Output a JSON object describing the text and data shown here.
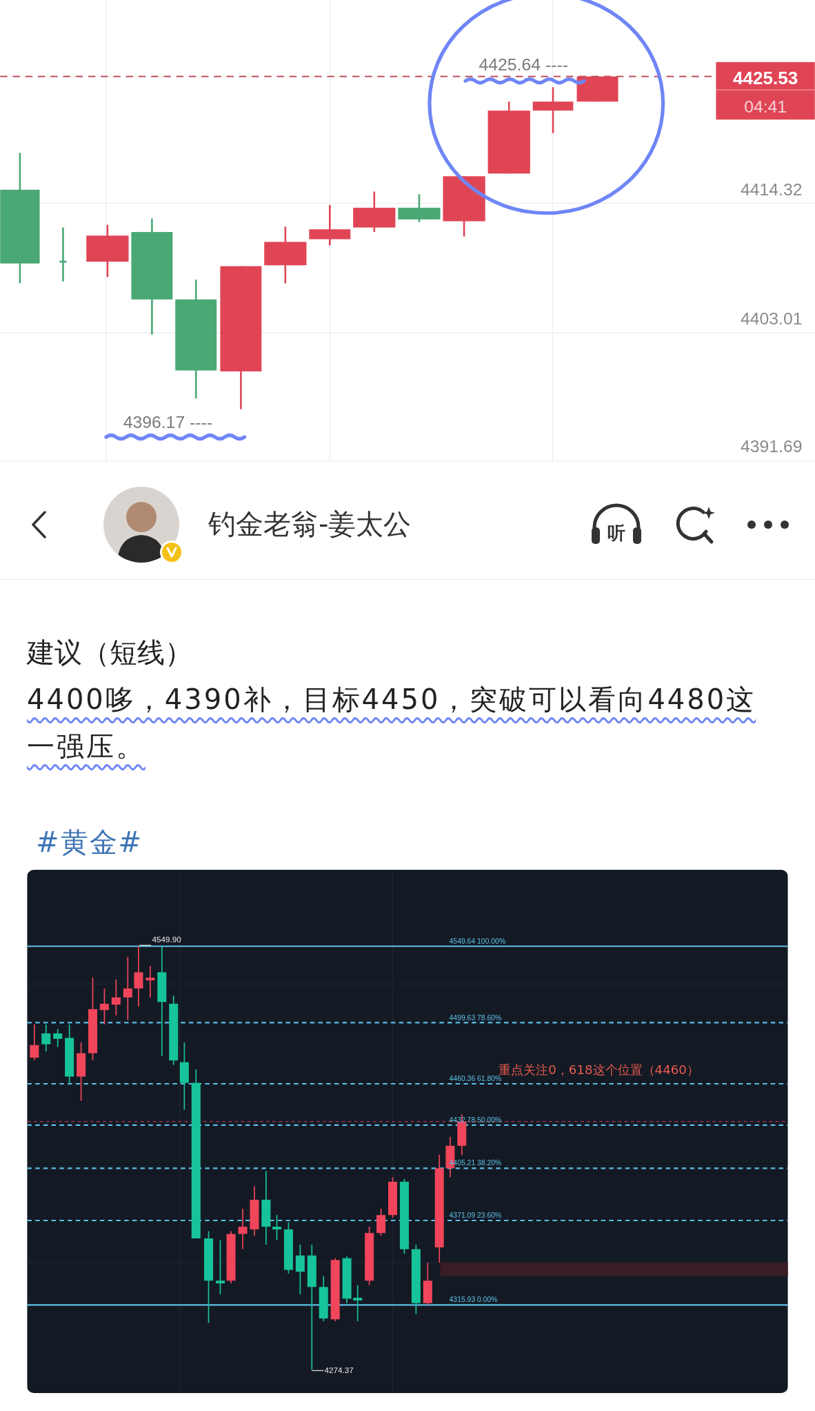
{
  "price_chart": {
    "axis_labels": [
      "4414.32",
      "4403.01",
      "4391.69"
    ],
    "current_price": "4425.53",
    "countdown": "04:41",
    "high_marker": "4425.64 ----",
    "low_marker": "4396.17 ----"
  },
  "header": {
    "author_name": "钓金老翁-姜太公",
    "verified": true,
    "listen_label": "听"
  },
  "post": {
    "heading": "建议（短线）",
    "body": "4400哆，4390补，目标4450，突破可以看向4480这一强压。",
    "hashtag": "#黄金#"
  },
  "image_chart": {
    "levels": [
      {
        "label": "4549.64 100.00%",
        "kind": "solid"
      },
      {
        "label": "4499.63 78.60%",
        "kind": "dashed"
      },
      {
        "label": "4460.36 61.80%",
        "kind": "dashed"
      },
      {
        "label": "4432.78 50.00%",
        "kind": "dashed"
      },
      {
        "label": "4405.21 38.20%",
        "kind": "dashed"
      },
      {
        "label": "4371.09 23.60%",
        "kind": "dashed"
      },
      {
        "label": "4315.93 0.00%",
        "kind": "solid"
      }
    ],
    "high_label": "4549.90",
    "low_label": "4274.37",
    "note": "重点关注0，618这个位置（4460）"
  }
}
